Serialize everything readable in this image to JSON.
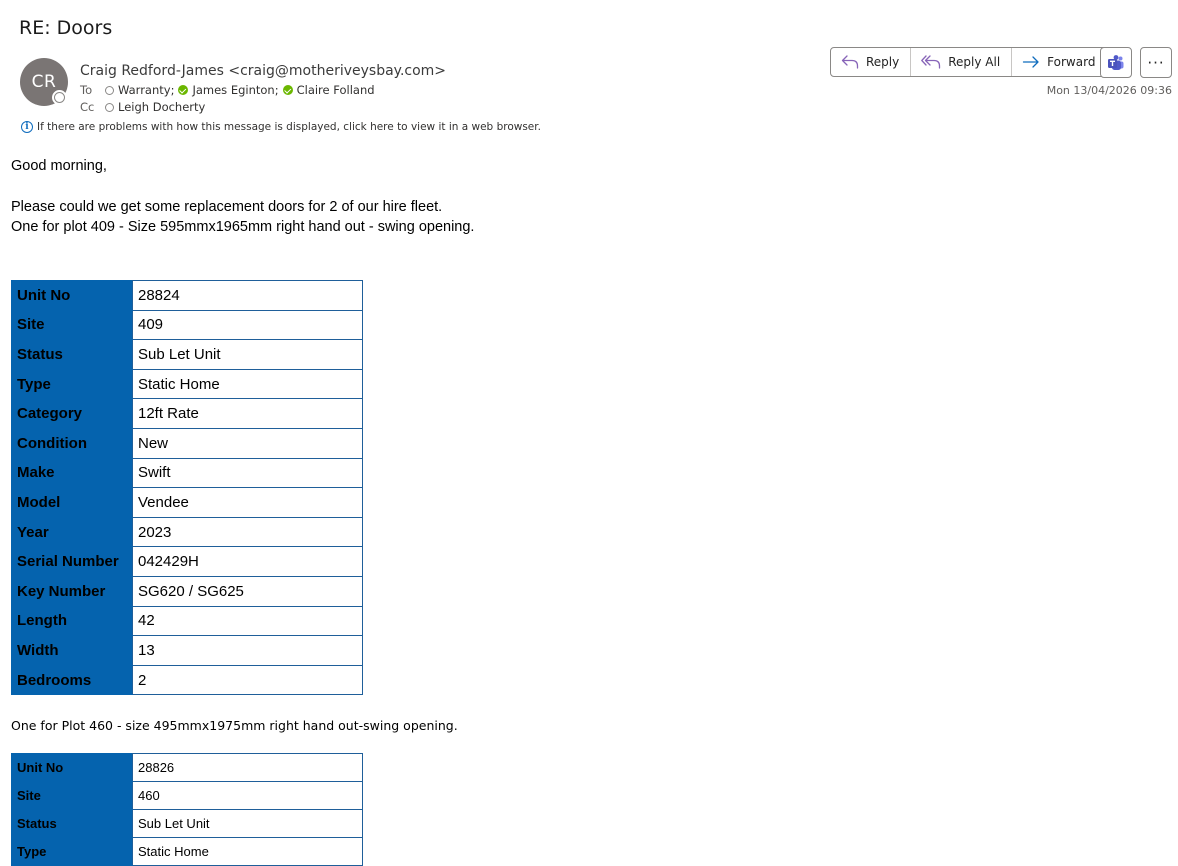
{
  "email": {
    "subject": "RE: Doors",
    "sender_initials": "CR",
    "sender": "Craig Redford-James <craig@motheriveysbay.com>",
    "to_label": "To",
    "to": [
      "Warranty;",
      "James Eginton;",
      "Claire Folland"
    ],
    "cc_label": "Cc",
    "cc": [
      "Leigh Docherty"
    ],
    "info_message": "If there are problems with how this message is displayed, click here to view it in a web browser.",
    "date": "Mon 13/04/2026 09:36"
  },
  "actions": {
    "reply": "Reply",
    "reply_all": "Reply All",
    "forward": "Forward",
    "more": "···"
  },
  "body": {
    "greeting": "Good morning,",
    "line1": "Please could we get some replacement doors for 2 of our hire fleet.",
    "line2": "One for plot 409 - Size 595mmx1965mm right hand out - swing opening.",
    "line3": "One for Plot 460 - size 495mmx1975mm right hand out-swing opening."
  },
  "table1": [
    {
      "k": "Unit No",
      "v": "28824"
    },
    {
      "k": "Site",
      "v": "409"
    },
    {
      "k": "Status",
      "v": "Sub Let Unit"
    },
    {
      "k": "Type",
      "v": "Static Home"
    },
    {
      "k": "Category",
      "v": "12ft Rate"
    },
    {
      "k": "Condition",
      "v": "New"
    },
    {
      "k": "Make",
      "v": "Swift"
    },
    {
      "k": "Model",
      "v": "Vendee"
    },
    {
      "k": "Year",
      "v": "2023"
    },
    {
      "k": "Serial Number",
      "v": "042429H"
    },
    {
      "k": "Key Number",
      "v": "SG620 / SG625"
    },
    {
      "k": "Length",
      "v": "42"
    },
    {
      "k": "Width",
      "v": "13"
    },
    {
      "k": "Bedrooms",
      "v": "2"
    }
  ],
  "table2": [
    {
      "k": "Unit No",
      "v": "28826"
    },
    {
      "k": "Site",
      "v": "460"
    },
    {
      "k": "Status",
      "v": "Sub Let Unit"
    },
    {
      "k": "Type",
      "v": "Static Home"
    }
  ],
  "colors": {
    "table_header_bg": "#0563ae",
    "presence_available": "#6bb700",
    "reply_icon": "#8764b8",
    "forward_icon": "#0f6cbd"
  }
}
